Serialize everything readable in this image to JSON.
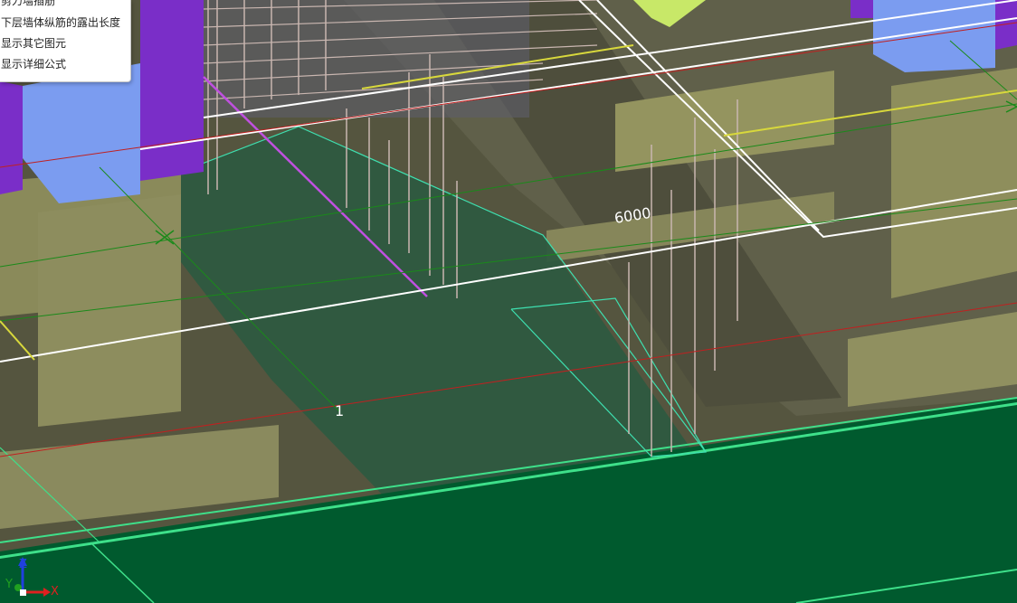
{
  "context_menu": {
    "items": [
      {
        "label": "剪力墙插筋"
      },
      {
        "label": "下层墙体纵筋的露出长度"
      },
      {
        "label": "显示其它图元"
      },
      {
        "label": "显示详细公式"
      }
    ]
  },
  "annotations": {
    "dimension_label": "6000",
    "axis_number": "1"
  },
  "axis_gizmo": {
    "labels": {
      "x": "X",
      "y": "Y",
      "z": "Z"
    },
    "colors": {
      "x": "#e02020",
      "y": "#20a020",
      "z": "#2040e0"
    }
  },
  "colors": {
    "slab": "#005a2e",
    "wall_panel": "#8a8a5a",
    "column_blue": "#7b9cf0",
    "column_purple": "#7a2ec8",
    "rebar": "#c9b6b0",
    "grid_white": "#ffffff"
  }
}
